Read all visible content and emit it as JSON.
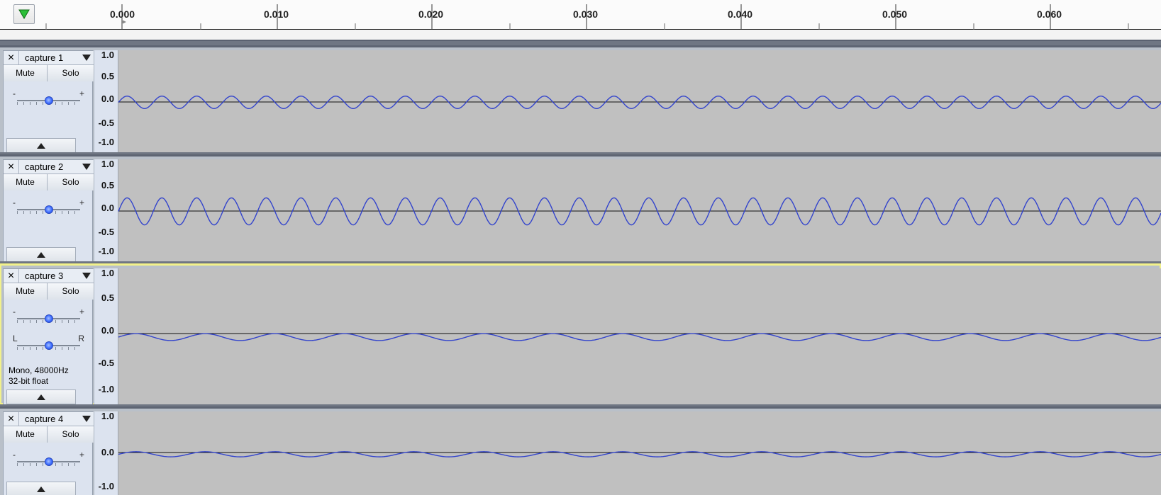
{
  "timeline": {
    "play_icon": "play-triangle-icon",
    "ticks": [
      "0.000",
      "0.010",
      "0.020",
      "0.030",
      "0.040",
      "0.050",
      "0.060"
    ]
  },
  "tracks": [
    {
      "name": "capture 1",
      "mute_label": "Mute",
      "solo_label": "Solo",
      "gain_left": "-",
      "gain_right": "+",
      "scale": [
        "1.0",
        "0.5",
        "0.0",
        "-0.5",
        "-1.0"
      ],
      "amplitude": 0.12,
      "cycles": 30,
      "color": "#3344cc"
    },
    {
      "name": "capture 2",
      "mute_label": "Mute",
      "solo_label": "Solo",
      "gain_left": "-",
      "gain_right": "+",
      "scale": [
        "1.0",
        "0.5",
        "0.0",
        "-0.5",
        "-1.0"
      ],
      "amplitude": 0.26,
      "cycles": 30,
      "color": "#3344cc"
    },
    {
      "name": "capture 3",
      "mute_label": "Mute",
      "solo_label": "Solo",
      "gain_left": "-",
      "gain_right": "+",
      "pan_left": "L",
      "pan_right": "R",
      "info_line_1": "Mono, 48000Hz",
      "info_line_2": "32-bit float",
      "scale": [
        "1.0",
        "0.5",
        "0.0",
        "-0.5",
        "-1.0"
      ],
      "amplitude": 0.05,
      "cycles": 15,
      "color": "#3344cc",
      "selected": true
    },
    {
      "name": "capture 4",
      "mute_label": "Mute",
      "solo_label": "Solo",
      "gain_left": "-",
      "gain_right": "+",
      "scale": [
        "1.0",
        "",
        "0.0",
        "",
        "-1.0"
      ],
      "amplitude": 0.06,
      "cycles": 15,
      "color": "#3344cc"
    }
  ]
}
